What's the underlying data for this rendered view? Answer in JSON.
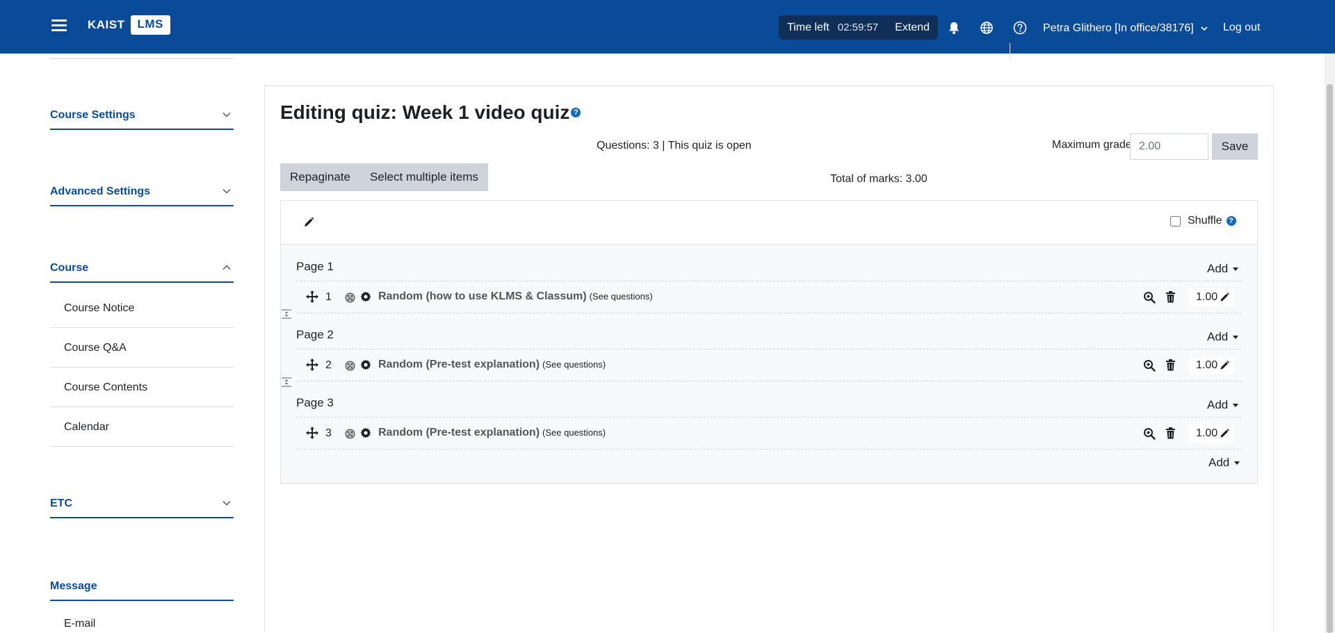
{
  "header": {
    "logo_text": "KAIST",
    "logo_box": "LMS",
    "time_left_label": "Time left",
    "time_left_value": "02:59:57",
    "extend_label": "Extend",
    "user_name": "Petra Glithero [In office/38176]",
    "logout_label": "Log out"
  },
  "sidebar": {
    "course_settings": "Course Settings",
    "advanced_settings": "Advanced Settings",
    "course": "Course",
    "course_items": [
      "Course Notice",
      "Course Q&A",
      "Course Contents",
      "Calendar"
    ],
    "etc": "ETC",
    "message": "Message",
    "message_items": [
      "E-mail"
    ]
  },
  "quiz": {
    "title": "Editing quiz: Week 1 video quiz",
    "questions_info": "Questions: 3 | This quiz is open",
    "max_grade_label": "Maximum grade",
    "max_grade_value": "2.00",
    "save_label": "Save",
    "repaginate_label": "Repaginate",
    "select_multiple_label": "Select multiple items",
    "total_marks": "Total of marks: 3.00",
    "shuffle_label": "Shuffle",
    "add_label": "Add",
    "see_questions": "(See questions)",
    "pages": [
      {
        "label": "Page 1",
        "number": "1",
        "name": "Random (how to use KLMS & Classum)",
        "mark": "1.00"
      },
      {
        "label": "Page 2",
        "number": "2",
        "name": "Random (Pre-test explanation)",
        "mark": "1.00"
      },
      {
        "label": "Page 3",
        "number": "3",
        "name": "Random (Pre-test explanation)",
        "mark": "1.00"
      }
    ]
  },
  "colors": {
    "brand": "#0a4b99",
    "timer_bg": "#0f2f58",
    "help": "#0f6cbf"
  }
}
